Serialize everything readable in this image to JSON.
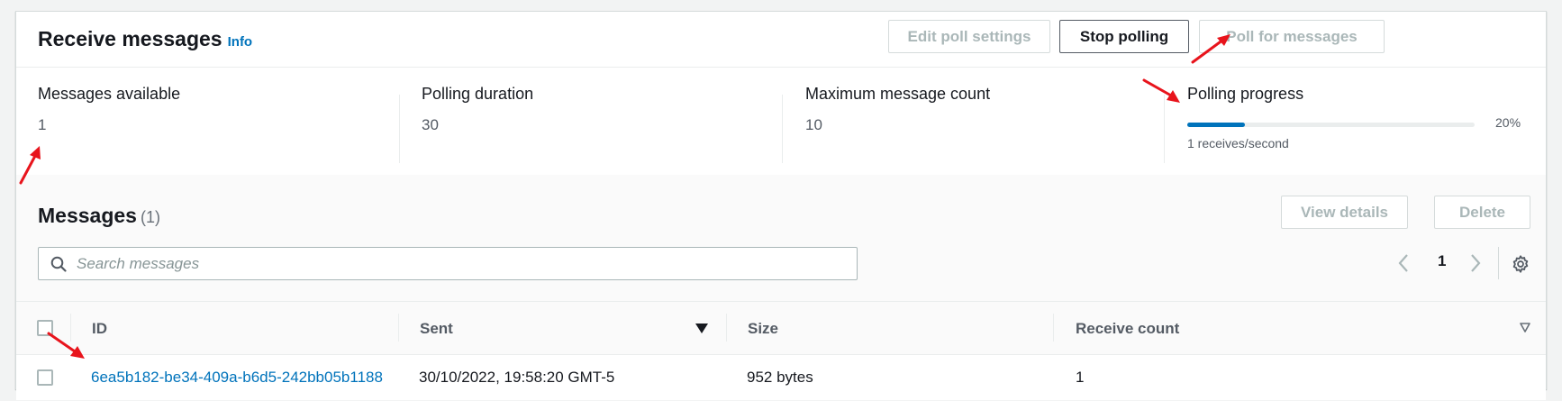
{
  "receive": {
    "title": "Receive messages",
    "info_label": "Info",
    "buttons": {
      "edit_poll_settings": "Edit poll settings",
      "stop_polling": "Stop polling",
      "poll_for_messages": "Poll for messages"
    },
    "stats": {
      "messages_available": {
        "label": "Messages available",
        "value": "1"
      },
      "polling_duration": {
        "label": "Polling duration",
        "value": "30"
      },
      "maximum_message_count": {
        "label": "Maximum message count",
        "value": "10"
      },
      "polling_progress": {
        "label": "Polling progress",
        "percent_label": "20%",
        "percent": 20,
        "rate": "1 receives/second"
      }
    }
  },
  "messages": {
    "title": "Messages",
    "count": "(1)",
    "buttons": {
      "view_details": "View details",
      "delete": "Delete"
    },
    "search": {
      "placeholder": "Search messages",
      "value": ""
    },
    "pagination": {
      "current_page": "1"
    },
    "columns": [
      "ID",
      "Sent",
      "Size",
      "Receive count"
    ],
    "rows": [
      {
        "id": "6ea5b182-be34-409a-b6d5-242bb05b1188",
        "sent": "30/10/2022, 19:58:20 GMT-5",
        "size": "952 bytes",
        "receive_count": "1"
      }
    ]
  },
  "colors": {
    "accent": "#0073bb",
    "annotation_arrow": "#e8141c",
    "disabled_text": "#aab7b8",
    "border": "#d5dbdb"
  },
  "icons": [
    "search-icon",
    "chevron-left-icon",
    "chevron-right-icon",
    "gear-icon",
    "sort-descending-icon",
    "sort-neutral-icon"
  ]
}
